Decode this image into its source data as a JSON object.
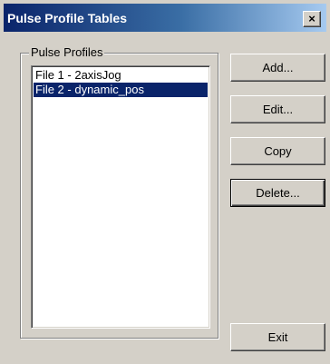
{
  "window": {
    "title": "Pulse Profile Tables",
    "close_label": "×"
  },
  "group": {
    "label": "Pulse Profiles"
  },
  "profiles": [
    {
      "label": "File 1 - 2axisJog",
      "selected": false
    },
    {
      "label": "File 2 - dynamic_pos",
      "selected": true
    }
  ],
  "buttons": {
    "add": "Add...",
    "edit": "Edit...",
    "copy": "Copy",
    "delete": "Delete...",
    "exit": "Exit"
  },
  "colors": {
    "title_gradient_start": "#0a246a",
    "title_gradient_end": "#a6caf0",
    "selection": "#0a246a",
    "face": "#d4d0c8"
  }
}
